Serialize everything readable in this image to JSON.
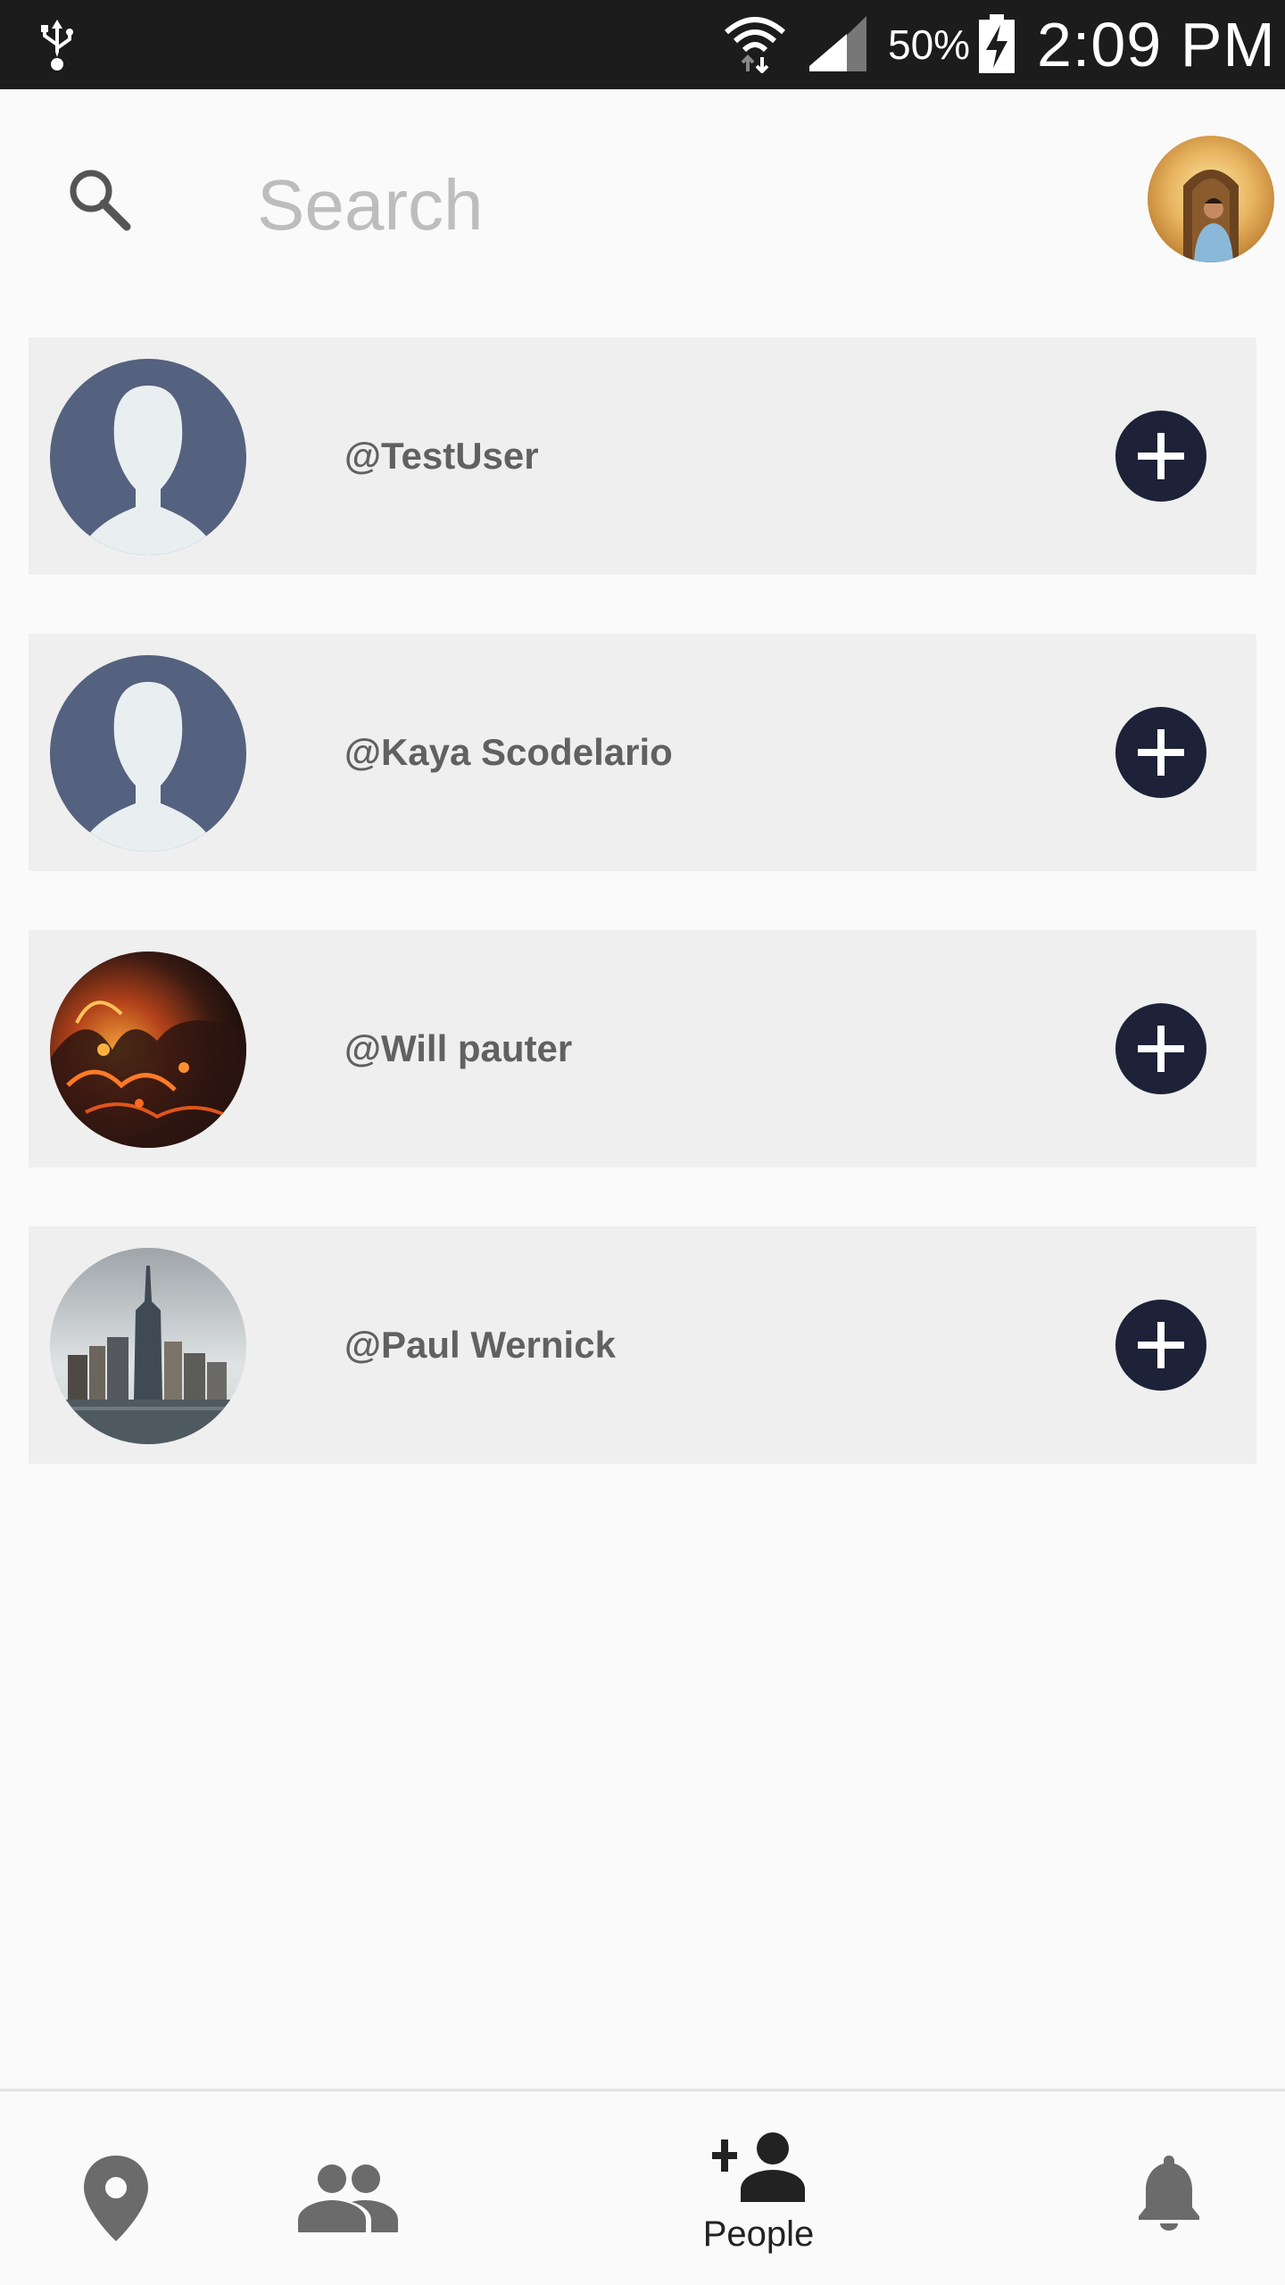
{
  "status_bar": {
    "battery_percent": "50%",
    "time": "2:09 PM",
    "icons": [
      "usb-icon",
      "wifi-icon",
      "cell-signal-icon",
      "battery-charging-icon"
    ]
  },
  "search": {
    "placeholder": "Search",
    "value": ""
  },
  "people": [
    {
      "username": "@TestUser",
      "avatar": "default-silhouette"
    },
    {
      "username": "@Kaya Scodelario",
      "avatar": "default-silhouette"
    },
    {
      "username": "@Will pauter",
      "avatar": "photo-fire"
    },
    {
      "username": "@Paul Wernick",
      "avatar": "photo-city-skyline"
    }
  ],
  "bottom_nav": {
    "items": [
      {
        "id": "location",
        "icon": "location-pin-icon",
        "label": ""
      },
      {
        "id": "friends",
        "icon": "friends-icon",
        "label": ""
      },
      {
        "id": "people",
        "icon": "add-person-icon",
        "label": "People",
        "active": true
      },
      {
        "id": "notifications",
        "icon": "bell-icon",
        "label": ""
      }
    ]
  },
  "colors": {
    "status_bar_bg": "#1c1c1c",
    "card_bg": "#efefef",
    "add_button_bg": "#1d2238",
    "silhouette_bg": "#54617f",
    "username_text": "#616161"
  }
}
